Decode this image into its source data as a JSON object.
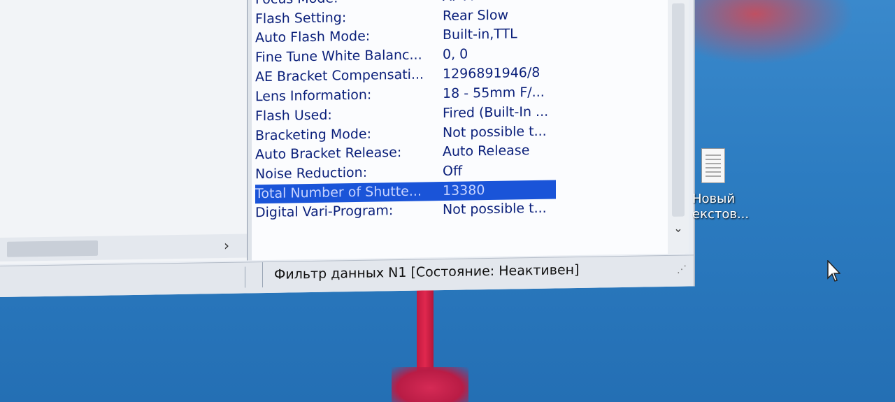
{
  "properties": [
    {
      "key": "Focus Mode:",
      "value": "AF-A"
    },
    {
      "key": "Flash Setting:",
      "value": "Rear Slow"
    },
    {
      "key": "Auto Flash Mode:",
      "value": "Built-in,TTL"
    },
    {
      "key": "Fine Tune White Balanc...",
      "value": "0, 0"
    },
    {
      "key": "AE Bracket Compensati...",
      "value": "1296891946/8"
    },
    {
      "key": "Lens Information:",
      "value": "18 - 55mm  F/..."
    },
    {
      "key": "Flash Used:",
      "value": "Fired (Built-In ..."
    },
    {
      "key": "Bracketing Mode:",
      "value": "Not possible t..."
    },
    {
      "key": "Auto Bracket Release:",
      "value": "Auto Release"
    },
    {
      "key": "Noise Reduction:",
      "value": "Off"
    },
    {
      "key": "Total Number of Shutte...",
      "value": "13380",
      "selected": true
    },
    {
      "key": "Digital Vari-Program:",
      "value": "Not possible t..."
    }
  ],
  "statusbar": {
    "text": "Фильтр данных N1 [Состояние: Неактивен]"
  },
  "desktop_icon": {
    "line1": "Новый",
    "line2": "екстов..."
  },
  "icons": {
    "scroll_right": "chevron-right-icon",
    "scroll_down": "chevron-down-icon",
    "resize_grip": "resize-grip-icon",
    "document": "text-document-icon",
    "cursor": "mouse-pointer-icon"
  },
  "colors": {
    "selection": "#1a54d8",
    "property_text": "#0a1f7a",
    "desktop": "#2c7cc1"
  }
}
